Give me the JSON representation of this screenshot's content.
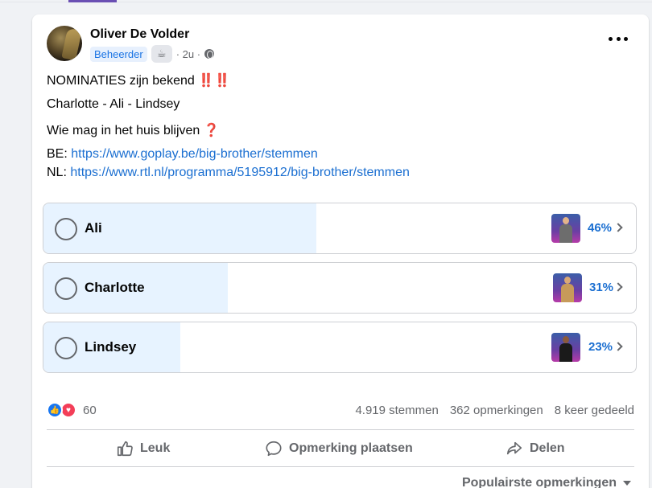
{
  "post": {
    "author": "Oliver De Volder",
    "role_badge": "Beheerder",
    "badge_icon": "☕",
    "time": "· 2u ·",
    "lines": {
      "line1": "NOMINATIES zijn bekend",
      "line1_emoji": "‼️‼️",
      "line2": "Charlotte - Ali - Lindsey",
      "line3": "Wie mag in het huis blijven",
      "line3_emoji": "❓",
      "be_prefix": "BE:",
      "be_link": "https://www.goplay.be/big-brother/stemmen",
      "nl_prefix": "NL:",
      "nl_link": "https://www.rtl.nl/programma/5195912/big-brother/stemmen"
    }
  },
  "poll": {
    "options": [
      {
        "label": "Ali",
        "percent_text": "46%",
        "percent": 46
      },
      {
        "label": "Charlotte",
        "percent_text": "31%",
        "percent": 31
      },
      {
        "label": "Lindsey",
        "percent_text": "23%",
        "percent": 23
      }
    ]
  },
  "footer": {
    "reaction_count": "60",
    "votes": "4.919 stemmen",
    "comments": "362 opmerkingen",
    "shares": "8 keer gedeeld"
  },
  "actions": {
    "like": "Leuk",
    "comment": "Opmerking plaatsen",
    "share": "Delen"
  },
  "sort_label": "Populairste opmerkingen",
  "colors": {
    "accent": "#1b6fd1",
    "poll_fill": "#e7f3ff",
    "like": "#1877f2",
    "love": "#f33e58"
  }
}
